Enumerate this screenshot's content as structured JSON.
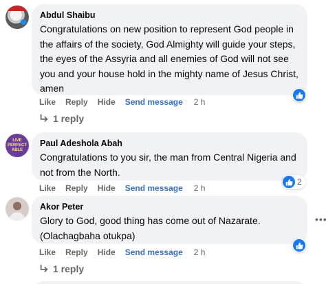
{
  "comments": [
    {
      "author": "Abdul Shaibu",
      "text": "Congratulations on new position to represent God people in the affairs of the society, God Almighty will guide your steps, the eyes of the Assyria and all enemies of God will not see you and your house hold in the mighty name of Jesus Christ, amen",
      "like": "Like",
      "reply": "Reply",
      "hide": "Hide",
      "send_message": "Send message",
      "time": "2 h",
      "reaction_count": "",
      "replies_label": "1 reply"
    },
    {
      "author": "Paul Adeshola Abah",
      "avatar_text": "LIVE PERFECT ABLE",
      "text": "Congratulations to you sir, the man from Central Nigeria and not from the North.",
      "like": "Like",
      "reply": "Reply",
      "hide": "Hide",
      "send_message": "Send message",
      "time": "2 h",
      "reaction_count": "2"
    },
    {
      "author": "Akor Peter",
      "text": "Glory to God, good thing has come out of Nazarate. (Olachagbaha otukpa)",
      "like": "Like",
      "reply": "Reply",
      "hide": "Hide",
      "send_message": "Send message",
      "time": "2 h",
      "reaction_count": "",
      "replies_label": "1 reply"
    }
  ],
  "colors": {
    "bubble": "#f0f2f5",
    "link": "#3b6fc2",
    "muted": "#65676b",
    "like_blue": "#1877f2"
  },
  "icons": [
    "thumbs-up-icon",
    "reply-arrow-icon",
    "more-options-icon"
  ]
}
